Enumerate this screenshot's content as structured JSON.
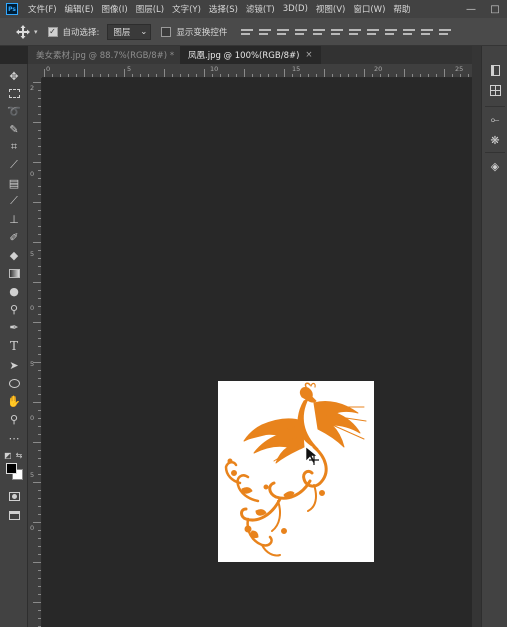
{
  "app": {
    "logo": "Ps"
  },
  "menu": [
    "文件(F)",
    "编辑(E)",
    "图像(I)",
    "图层(L)",
    "文字(Y)",
    "选择(S)",
    "滤镜(T)",
    "3D(D)",
    "视图(V)",
    "窗口(W)",
    "帮助"
  ],
  "window_controls": {
    "minimize": "—",
    "maximize": "□"
  },
  "options": {
    "auto_select_label": "自动选择:",
    "auto_select_checked": true,
    "auto_select_target": "图层",
    "show_transform_label": "显示变换控件",
    "show_transform_checked": false
  },
  "tabs": [
    {
      "title": "美女素材.jpg @ 88.7%(RGB/8#) *",
      "active": false
    },
    {
      "title": "凤凰.jpg @ 100%(RGB/8#)",
      "active": true,
      "close": "×"
    }
  ],
  "ruler_h_labels": [
    "0",
    "5",
    "10",
    "15",
    "20",
    "25"
  ],
  "ruler_v_labels": [
    "2",
    "0",
    "5",
    "0",
    "5",
    "0",
    "5",
    "0"
  ],
  "canvas": {
    "background": "#282828",
    "document_bg": "#ffffff",
    "artwork": "phoenix",
    "artwork_color": "#e8831c"
  },
  "tools": [
    "move-tool-icon",
    "marquee-tool-icon",
    "lasso-tool-icon",
    "quick-select-tool-icon",
    "crop-tool-icon",
    "eyedropper-tool-icon",
    "healing-brush-icon",
    "brush-tool-icon",
    "clone-stamp-icon",
    "history-brush-icon",
    "eraser-tool-icon",
    "gradient-tool-icon",
    "blur-tool-icon",
    "dodge-tool-icon",
    "pen-tool-icon",
    "type-tool-icon",
    "path-select-icon",
    "ellipse-tool-icon",
    "hand-tool-icon",
    "zoom-tool-icon",
    "more-tools-icon"
  ],
  "colors": {
    "foreground": "#000000",
    "background": "#ffffff"
  },
  "right_panel": [
    "properties-icon",
    "grid-icon",
    "paths-icon",
    "channels-icon",
    "layers-icon"
  ]
}
